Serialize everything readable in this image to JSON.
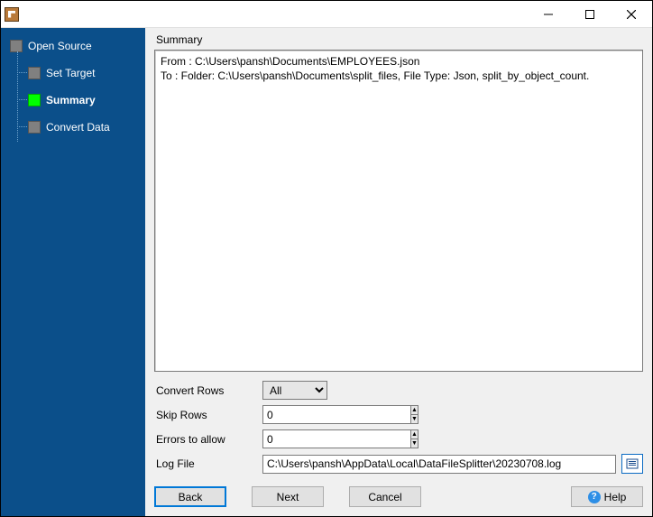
{
  "window": {
    "title": ""
  },
  "sidebar": {
    "items": [
      {
        "label": "Open Source",
        "active": false
      },
      {
        "label": "Set Target",
        "active": false
      },
      {
        "label": "Summary",
        "active": true
      },
      {
        "label": "Convert Data",
        "active": false
      }
    ]
  },
  "summary": {
    "heading": "Summary",
    "text": "From : C:\\Users\\pansh\\Documents\\EMPLOYEES.json\nTo : Folder: C:\\Users\\pansh\\Documents\\split_files, File Type: Json, split_by_object_count."
  },
  "form": {
    "convert_rows_label": "Convert Rows",
    "convert_rows_value": "All",
    "convert_rows_options": [
      "All"
    ],
    "skip_rows_label": "Skip Rows",
    "skip_rows_value": "0",
    "errors_label": "Errors to allow",
    "errors_value": "0",
    "log_label": "Log File",
    "log_value": "C:\\Users\\pansh\\AppData\\Local\\DataFileSplitter\\20230708.log"
  },
  "buttons": {
    "back": "Back",
    "next": "Next",
    "cancel": "Cancel",
    "help": "Help"
  }
}
